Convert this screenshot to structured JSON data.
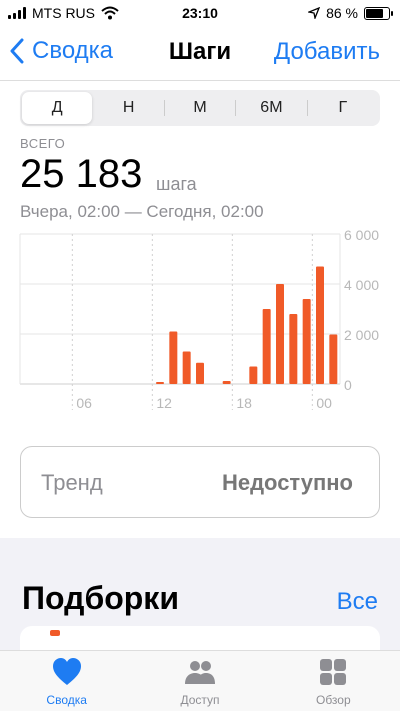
{
  "status_bar": {
    "carrier": "MTS RUS",
    "time": "23:10",
    "battery_percent": "86 %",
    "battery_level": 0.86
  },
  "nav": {
    "back_label": "Сводка",
    "title": "Шаги",
    "add_label": "Добавить"
  },
  "segments": [
    {
      "label": "Д",
      "active": true
    },
    {
      "label": "Н",
      "active": false
    },
    {
      "label": "М",
      "active": false
    },
    {
      "label": "6М",
      "active": false
    },
    {
      "label": "Г",
      "active": false
    }
  ],
  "summary": {
    "total_label": "ВСЕГО",
    "total_value": "25 183",
    "unit": "шага",
    "date_range": "Вчера, 02:00 — Сегодня, 02:00"
  },
  "chart_data": {
    "type": "bar",
    "x_tick_labels": [
      "06",
      "12",
      "18",
      "00"
    ],
    "y_tick_labels": [
      "6 000",
      "4 000",
      "2 000",
      "0"
    ],
    "ylim": [
      0,
      6000
    ],
    "bar_color": "#f05a28",
    "hours": [
      2,
      3,
      4,
      5,
      6,
      7,
      8,
      9,
      10,
      11,
      12,
      13,
      14,
      15,
      16,
      17,
      18,
      19,
      20,
      21,
      22,
      23,
      0,
      1
    ],
    "values": [
      0,
      0,
      0,
      0,
      0,
      0,
      0,
      0,
      0,
      0,
      80,
      2100,
      1300,
      850,
      0,
      120,
      0,
      700,
      3000,
      4000,
      2800,
      3400,
      4700,
      1980
    ]
  },
  "trend": {
    "label": "Тренд",
    "value": "Недоступно"
  },
  "section": {
    "title": "Подборки",
    "all_label": "Все"
  },
  "tabs": [
    {
      "label": "Сводка",
      "icon": "heart-icon",
      "active": true
    },
    {
      "label": "Доступ",
      "icon": "people-icon",
      "active": false
    },
    {
      "label": "Обзор",
      "icon": "grid-icon",
      "active": false
    }
  ],
  "colors": {
    "accent": "#1e7cf2",
    "steps": "#f05a28"
  }
}
